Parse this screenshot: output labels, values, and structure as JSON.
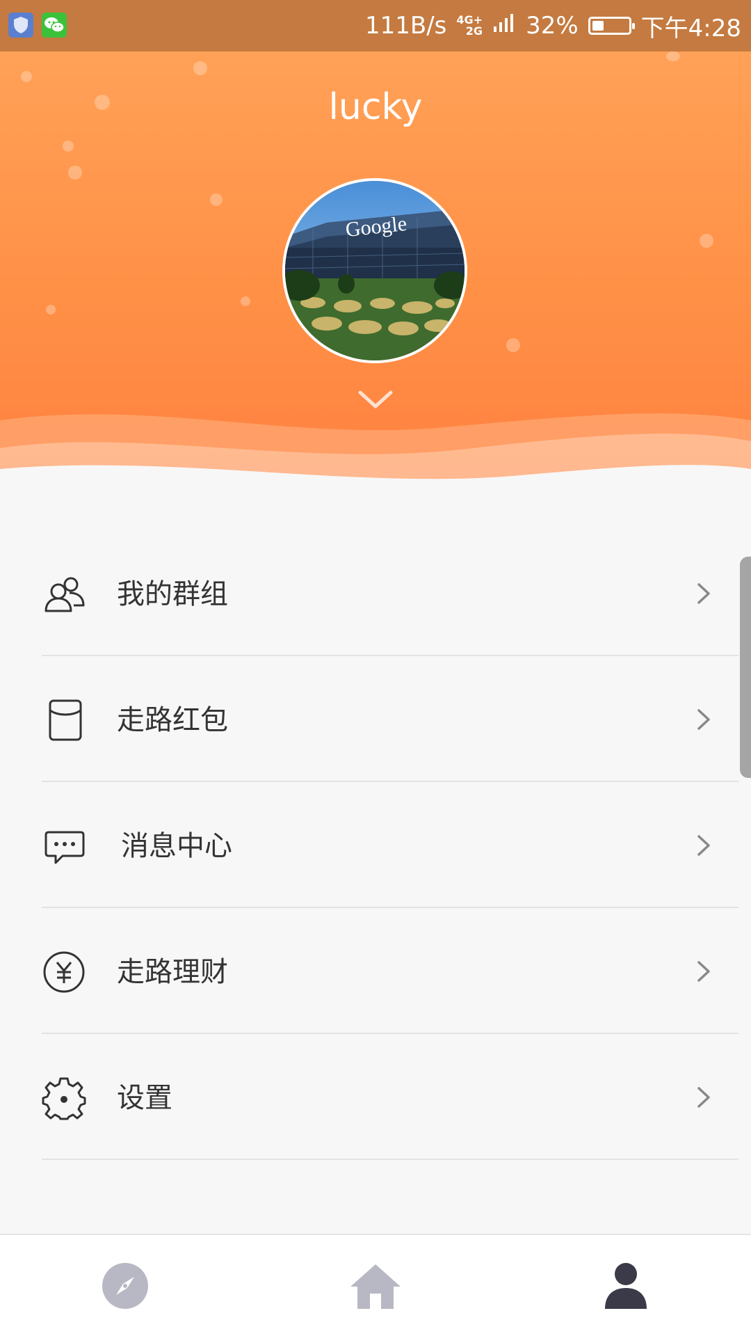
{
  "status_bar": {
    "speed": "111B/s",
    "network_top": "4G+",
    "network_bottom": "2G",
    "battery_percent": "32%",
    "battery_level": 0.32,
    "time": "下午4:28",
    "icons": [
      "shield-icon",
      "wechat-icon",
      "signal-icon",
      "battery-icon"
    ]
  },
  "header": {
    "username": "lucky",
    "avatar_icon": "avatar-photo",
    "expand_icon": "chevron-down-icon"
  },
  "menu": {
    "items": [
      {
        "label": "我的群组",
        "icon": "group-icon"
      },
      {
        "label": "走路红包",
        "icon": "red-envelope-icon"
      },
      {
        "label": "消息中心",
        "icon": "message-icon"
      },
      {
        "label": "走路理财",
        "icon": "yuan-coin-icon"
      },
      {
        "label": "设置",
        "icon": "gear-icon"
      }
    ],
    "arrow_icon": "chevron-right-icon"
  },
  "bottom_nav": {
    "tabs": [
      {
        "icon": "compass-icon",
        "active": false
      },
      {
        "icon": "home-icon",
        "active": false
      },
      {
        "icon": "person-icon",
        "active": true
      }
    ]
  },
  "colors": {
    "header_top": "#ffa157",
    "header_bottom": "#ff8040",
    "status_bar": "#c47a40",
    "text": "#333333",
    "icon": "#333333",
    "nav_inactive": "#b8b8c4",
    "nav_active": "#3a3a48"
  }
}
